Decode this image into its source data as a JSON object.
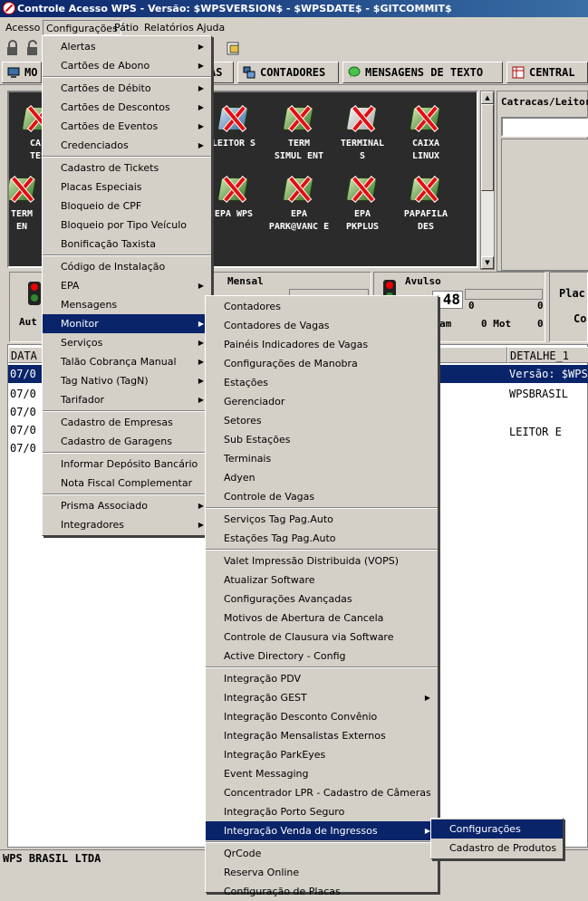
{
  "window": {
    "title": "Controle Acesso WPS - Versão: $WPSVERSION$ - $WPSDATE$ - $GITCOMMIT$"
  },
  "menubar": [
    "Acesso",
    "Configurações",
    "Pátio",
    "Relatórios",
    "Ajuda"
  ],
  "tabs": [
    {
      "label": "MO"
    },
    {
      "label": "AS"
    },
    {
      "label": "CONTADORES"
    },
    {
      "label": "MENSAGENS DE TEXTO"
    },
    {
      "label": "CENTRAL"
    }
  ],
  "icons": [
    {
      "l1": "CAI",
      "l2": "TES"
    },
    {
      "l1": "",
      "l2": ""
    },
    {
      "l1": "",
      "l2": ""
    },
    {
      "l1": "LEITOR S",
      "l2": ""
    },
    {
      "l1": "TERM",
      "l2": "SIMUL ENT"
    },
    {
      "l1": "TERMINAL",
      "l2": "S"
    },
    {
      "l1": "CAIXA",
      "l2": "LINUX"
    },
    {
      "l1": "TERM",
      "l2": "EN"
    },
    {
      "l1": "",
      "l2": ""
    },
    {
      "l1": "",
      "l2": ""
    },
    {
      "l1": "EPA WPS",
      "l2": ""
    },
    {
      "l1": "EPA",
      "l2": "PARK@VANC E"
    },
    {
      "l1": "EPA",
      "l2": "PKPLUS"
    },
    {
      "l1": "PAPAFILA",
      "l2": "DES"
    }
  ],
  "right_panel": {
    "title": "Catracas/Leitores"
  },
  "counters": {
    "aut": "Aut",
    "mensal": "Mensal",
    "avulso": "Avulso",
    "big_number": "48",
    "avulso_a": "0",
    "avulso_b": "0",
    "mam": "am",
    "mot": "0 Mot",
    "mot_val": "0",
    "placa": "Plac",
    "co": "Co"
  },
  "grid": {
    "headers": [
      "DATA",
      "DETALHE_1"
    ],
    "rows": [
      {
        "date": "07/0",
        "detail": "Versão: $WPSVERSION$",
        "selected": true
      },
      {
        "date": "07/0",
        "detail": "WPSBRASIL",
        "selected": false
      },
      {
        "date": "07/0",
        "detail": "",
        "selected": false
      },
      {
        "date": "07/0",
        "detail": "LEITOR E",
        "selected": false
      },
      {
        "date": "07/0",
        "detail": "",
        "selected": false
      }
    ]
  },
  "status": {
    "company": "WPS BRASIL LTDA"
  },
  "config_menu": [
    {
      "label": "Alertas",
      "sub": true
    },
    {
      "label": "Cartões de Abono",
      "sub": true
    },
    {
      "sep": true
    },
    {
      "label": "Cartões de Débito",
      "sub": true
    },
    {
      "label": "Cartões de Descontos",
      "sub": true
    },
    {
      "label": "Cartões de Eventos",
      "sub": true
    },
    {
      "label": "Credenciados",
      "sub": true
    },
    {
      "sep": true
    },
    {
      "label": "Cadastro de Tickets"
    },
    {
      "label": "Placas Especiais"
    },
    {
      "label": "Bloqueio de CPF"
    },
    {
      "label": "Bloqueio por Tipo Veículo"
    },
    {
      "label": "Bonificação Taxista"
    },
    {
      "sep": true
    },
    {
      "label": "Código de Instalação"
    },
    {
      "label": "EPA",
      "sub": true
    },
    {
      "label": "Mensagens"
    },
    {
      "label": "Monitor",
      "sub": true,
      "hl": true
    },
    {
      "label": "Serviços",
      "sub": true
    },
    {
      "label": "Talão Cobrança Manual",
      "sub": true
    },
    {
      "label": "Tag Nativo (TagN)",
      "sub": true
    },
    {
      "label": "Tarifador",
      "sub": true
    },
    {
      "sep": true
    },
    {
      "label": "Cadastro de Empresas"
    },
    {
      "label": "Cadastro de Garagens"
    },
    {
      "sep": true
    },
    {
      "label": "Informar Depósito Bancário"
    },
    {
      "label": "Nota Fiscal Complementar"
    },
    {
      "sep": true
    },
    {
      "label": "Prisma Associado",
      "sub": true
    },
    {
      "label": "Integradores",
      "sub": true
    }
  ],
  "monitor_menu": [
    {
      "label": "Contadores"
    },
    {
      "label": "Contadores de Vagas"
    },
    {
      "label": "Painéis Indicadores de Vagas"
    },
    {
      "label": "Configurações de Manobra"
    },
    {
      "label": "Estações"
    },
    {
      "label": "Gerenciador"
    },
    {
      "label": "Setores"
    },
    {
      "label": "Sub Estações"
    },
    {
      "label": "Terminais"
    },
    {
      "label": "Adyen"
    },
    {
      "label": "Controle de Vagas"
    },
    {
      "sep": true
    },
    {
      "label": "Serviços Tag Pag.Auto"
    },
    {
      "label": "Estações Tag Pag.Auto"
    },
    {
      "sep": true
    },
    {
      "label": "Valet Impressão Distribuida (VOPS)"
    },
    {
      "label": "Atualizar Software"
    },
    {
      "label": "Configurações Avançadas"
    },
    {
      "label": "Motivos de Abertura de Cancela"
    },
    {
      "label": "Controle de Clausura via Software"
    },
    {
      "label": "Active Directory - Config"
    },
    {
      "sep": true
    },
    {
      "label": "Integração PDV"
    },
    {
      "label": "Integração GEST",
      "sub": true
    },
    {
      "label": "Integração Desconto Convênio"
    },
    {
      "label": "Integração Mensalistas Externos"
    },
    {
      "label": "Integração ParkEyes"
    },
    {
      "label": "Event Messaging"
    },
    {
      "label": "Concentrador LPR - Cadastro de Câmeras"
    },
    {
      "label": "Integração Porto Seguro"
    },
    {
      "label": "Integração Venda de Ingressos",
      "sub": true,
      "hl": true
    },
    {
      "sep": true
    },
    {
      "label": "QrCode"
    },
    {
      "label": "Reserva Online"
    },
    {
      "label": "Configuração de Placas"
    }
  ],
  "ingressos_menu": [
    {
      "label": "Configurações",
      "hl": true
    },
    {
      "label": "Cadastro de Produtos"
    }
  ]
}
